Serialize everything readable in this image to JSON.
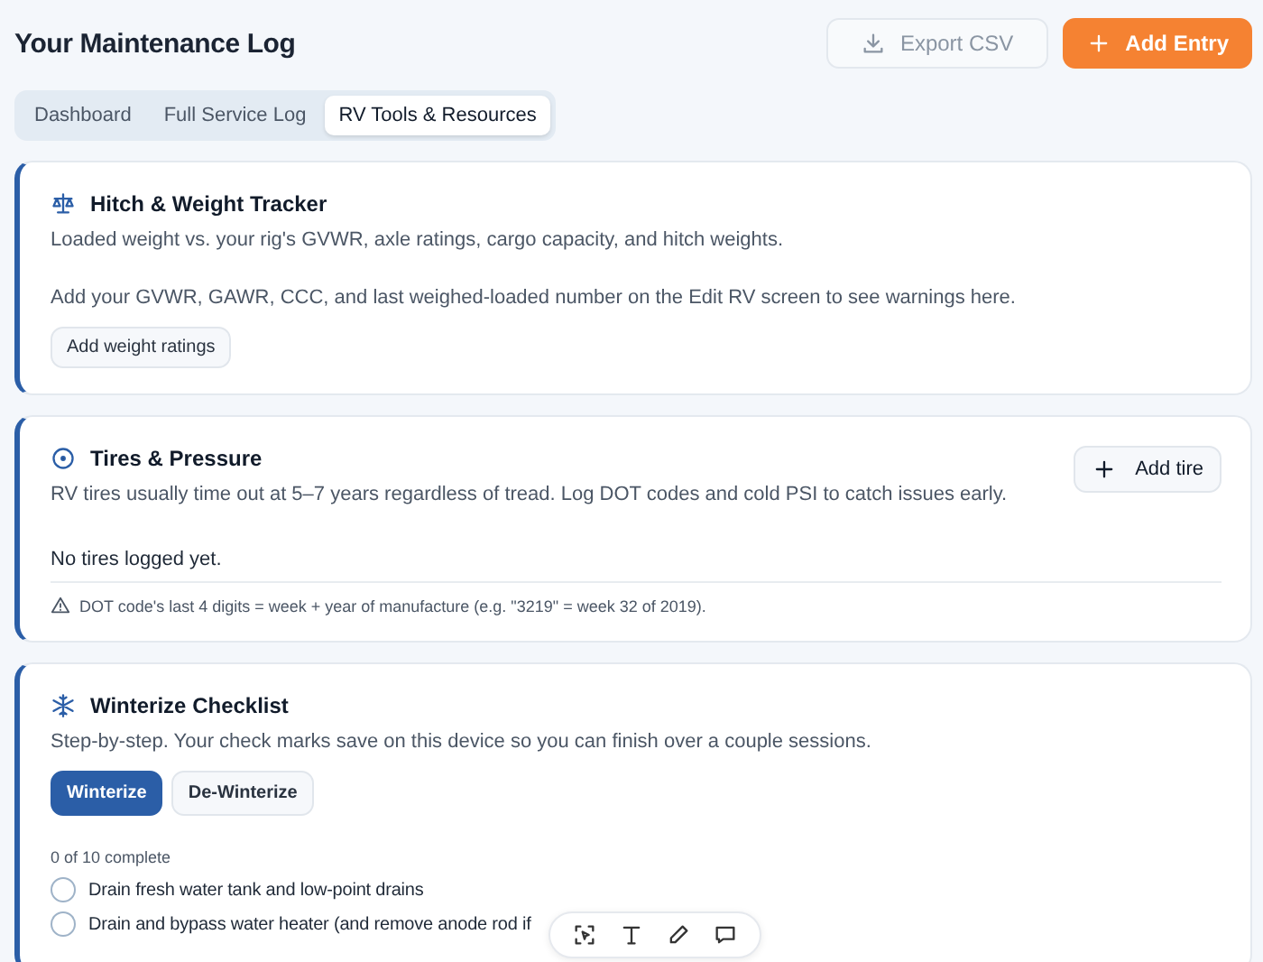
{
  "header": {
    "title": "Your Maintenance Log",
    "buttons": [
      {
        "label": "Export CSV",
        "kind": "secondary"
      },
      {
        "label": "Add Entry",
        "kind": "primary"
      }
    ]
  },
  "tabs": [
    {
      "label": "Dashboard",
      "selected": false
    },
    {
      "label": "Full Service Log",
      "selected": false
    },
    {
      "label": "RV Tools & Resources",
      "selected": true
    }
  ],
  "hitch": {
    "title": "Hitch & Weight Tracker",
    "description": "Loaded weight vs. your rig's GVWR, axle ratings, cargo capacity, and hitch weights.",
    "notice": "Add your GVWR, GAWR, CCC, and last weighed-loaded number on the Edit RV screen to see warnings here.",
    "button": "Add weight ratings"
  },
  "tires": {
    "title": "Tires & Pressure",
    "description": "RV tires usually time out at 5–7 years regardless of tread. Log DOT codes and cold PSI to catch issues early.",
    "button": "Add tire",
    "empty": "No tires logged yet.",
    "tip": "DOT code's last 4 digits = week + year of manufacture (e.g. \"3219\" = week 32 of 2019)."
  },
  "winterize": {
    "title": "Winterize Checklist",
    "description": "Step-by-step. Your check marks save on this device so you can finish over a couple sessions.",
    "modes": [
      {
        "label": "Winterize",
        "selected": true
      },
      {
        "label": "De-Winterize",
        "selected": false
      }
    ],
    "progress": "0 of 10 complete",
    "items": [
      {
        "label": "Drain fresh water tank and low-point drains",
        "checked": false
      },
      {
        "label": "Drain and bypass water heater (and remove anode rod if",
        "checked": false
      }
    ]
  }
}
